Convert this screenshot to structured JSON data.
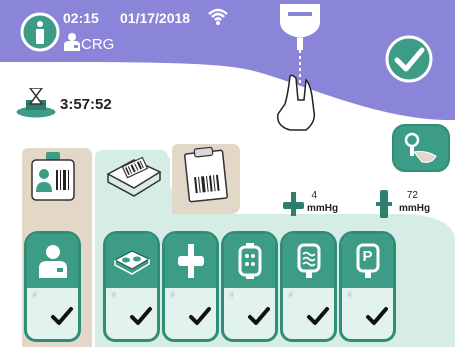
{
  "header": {
    "time": "02:15",
    "date": "01/17/2018",
    "user": "CRG",
    "info_icon": "info-icon",
    "wifi_icon": "wifi-icon",
    "confirm_icon": "checkmark-icon"
  },
  "timer": {
    "value": "3:57:52",
    "icon": "hourglass-icon"
  },
  "pressures": [
    {
      "icon": "arterial-pressure-icon",
      "value": "4",
      "unit": "mmHg"
    },
    {
      "icon": "venous-pressure-icon",
      "value": "72",
      "unit": "mmHg"
    }
  ],
  "top_tabs": [
    {
      "icon": "patient-id-card-icon"
    },
    {
      "icon": "device-barcode-icon"
    },
    {
      "icon": "clipboard-barcode-icon"
    }
  ],
  "cards": [
    {
      "icon": "patient-icon",
      "hash": "#"
    },
    {
      "icon": "cassette-icon",
      "hash": "#"
    },
    {
      "icon": "connector-icon",
      "hash": "#"
    },
    {
      "icon": "filter-icon",
      "hash": "#"
    },
    {
      "icon": "dialysate-bag-icon",
      "hash": "#"
    },
    {
      "icon": "p-bag-icon",
      "hash": "#",
      "label": "P"
    }
  ],
  "colors": {
    "header": "#8b85d9",
    "teal": "#3d9c86",
    "mint": "#d6ede5",
    "tan": "#e3d8c7"
  }
}
